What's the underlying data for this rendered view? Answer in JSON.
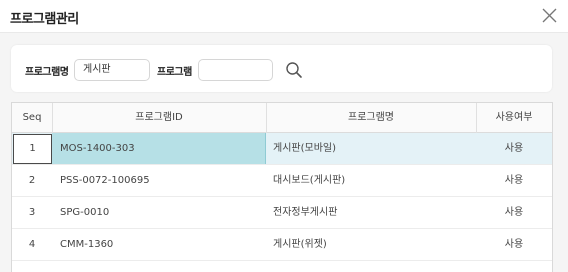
{
  "dialog": {
    "title": "프로그램관리"
  },
  "search": {
    "label_name": "프로그램명",
    "name_value": "게시판",
    "label_program": "프로그램",
    "program_value": ""
  },
  "grid": {
    "columns": [
      "Seq",
      "프로그램ID",
      "프로그램명",
      "사용여부"
    ],
    "rows": [
      {
        "seq": "1",
        "id": "MOS-1400-303",
        "name": "게시판(모바일)",
        "use": "사용",
        "selected": true
      },
      {
        "seq": "2",
        "id": "PSS-0072-100695",
        "name": "대시보드(게시판)",
        "use": "사용",
        "selected": false
      },
      {
        "seq": "3",
        "id": "SPG-0010",
        "name": "전자정부게시판",
        "use": "사용",
        "selected": false
      },
      {
        "seq": "4",
        "id": "CMM-1360",
        "name": "게시판(위젯)",
        "use": "사용",
        "selected": false
      }
    ]
  },
  "icons": {
    "close": "close-icon",
    "search": "search-icon"
  }
}
